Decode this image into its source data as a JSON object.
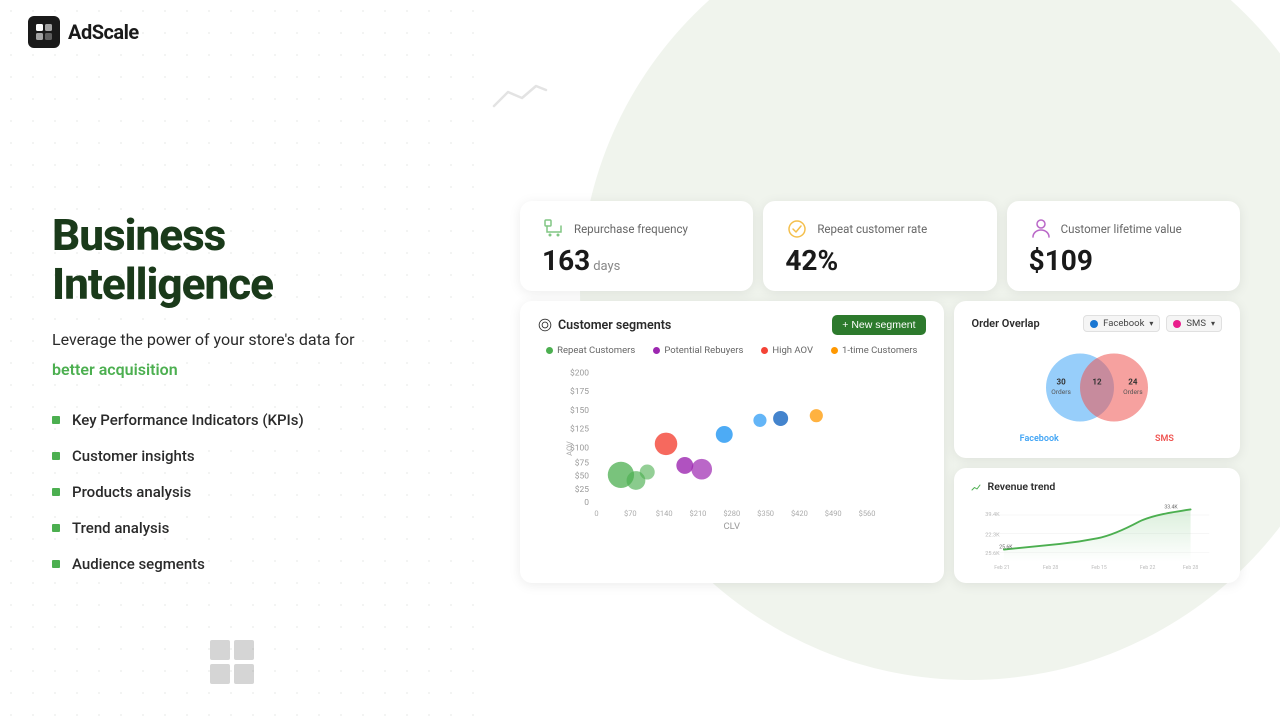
{
  "app": {
    "name": "AdScale",
    "logo_alt": "AdScale logo"
  },
  "hero": {
    "title": "Business Intelligence",
    "subtitle": "Leverage the power of your store's data for",
    "subtitle_green": "better acquisition",
    "features": [
      {
        "label": "Key Performance Indicators (KPIs)"
      },
      {
        "label": "Customer insights"
      },
      {
        "label": "Products analysis"
      },
      {
        "label": "Trend analysis"
      },
      {
        "label": "Audience segments"
      }
    ]
  },
  "kpis": [
    {
      "icon": "cart-icon",
      "label": "Repurchase frequency",
      "value": "163",
      "unit": "days"
    },
    {
      "icon": "repeat-icon",
      "label": "Repeat customer rate",
      "value": "42%",
      "unit": ""
    },
    {
      "icon": "person-icon",
      "label": "Customer lifetime value",
      "value": "$109",
      "unit": ""
    }
  ],
  "segments_card": {
    "title": "Customer segments",
    "new_button": "+ New segment",
    "legend": [
      {
        "label": "Repeat Customers",
        "color": "#4caf50"
      },
      {
        "label": "Potential Rebuyers",
        "color": "#9c27b0"
      },
      {
        "label": "High AOV",
        "color": "#f44336"
      },
      {
        "label": "1-time Customers",
        "color": "#ff9800"
      }
    ],
    "x_axis_label": "CLV",
    "y_axis_label": "AOV"
  },
  "overlap_card": {
    "title": "Order Overlap",
    "facebook_label": "Facebook",
    "sms_label": "SMS",
    "left_orders": "30",
    "center_orders": "12",
    "right_orders": "24",
    "left_channel": "Facebook",
    "right_channel": "SMS"
  },
  "revenue_card": {
    "title": "Revenue trend"
  }
}
